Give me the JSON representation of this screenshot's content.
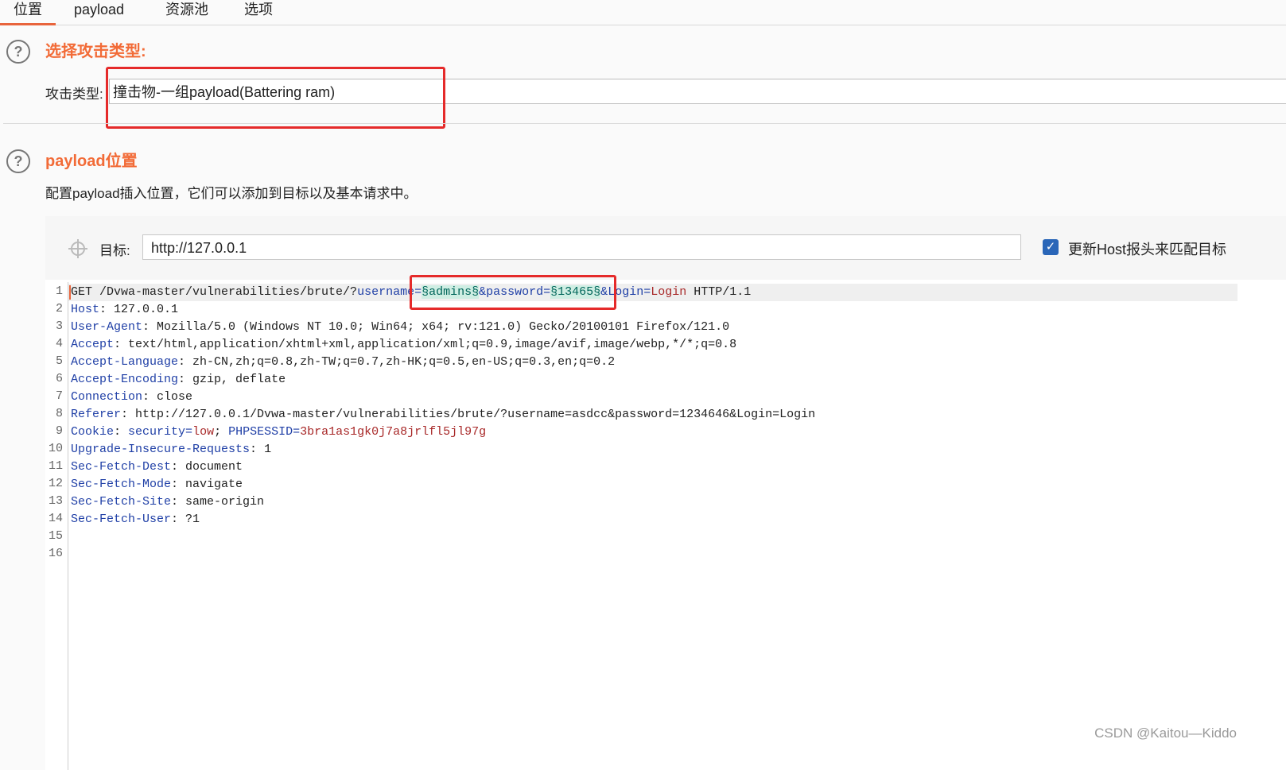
{
  "tabs": [
    {
      "label": "位置",
      "active": true
    },
    {
      "label": "payload",
      "active": false
    },
    {
      "label": "资源池",
      "active": false
    },
    {
      "label": "选项",
      "active": false
    }
  ],
  "attack_section": {
    "title": "选择攻击类型:",
    "type_label": "攻击类型:",
    "type_value": "撞击物-一组payload(Battering ram)"
  },
  "positions_section": {
    "title": "payload位置",
    "description": "配置payload插入位置，它们可以添加到目标以及基本请求中。",
    "target_label": "目标:",
    "target_value": "http://127.0.0.1",
    "update_host_label": "更新Host报头来匹配目标",
    "update_host_checked": true
  },
  "request": {
    "line1": {
      "method_path": "GET /Dvwa-master/vulnerabilities/brute/?",
      "p1_name": "username",
      "eq1": "=",
      "p1_value": "§admins§",
      "amp1": "&",
      "p2_name": "password",
      "eq2": "=",
      "p2_value": "§13465§",
      "amp2": "&",
      "p3_name": "Login",
      "eq3": "=",
      "p3_value": "Login",
      "version": " HTTP/1.1"
    },
    "headers": [
      {
        "name": "Host",
        "value": "127.0.0.1"
      },
      {
        "name": "User-Agent",
        "value": "Mozilla/5.0 (Windows NT 10.0; Win64; x64; rv:121.0) Gecko/20100101 Firefox/121.0"
      },
      {
        "name": "Accept",
        "value": "text/html,application/xhtml+xml,application/xml;q=0.9,image/avif,image/webp,*/*;q=0.8"
      },
      {
        "name": "Accept-Language",
        "value": "zh-CN,zh;q=0.8,zh-TW;q=0.7,zh-HK;q=0.5,en-US;q=0.3,en;q=0.2"
      },
      {
        "name": "Accept-Encoding",
        "value": "gzip, deflate"
      },
      {
        "name": "Connection",
        "value": "close"
      },
      {
        "name": "Referer",
        "value": "http://127.0.0.1/Dvwa-master/vulnerabilities/brute/?username=asdcc&password=1234646&Login=Login"
      }
    ],
    "cookie": {
      "name": "Cookie",
      "k1": "security",
      "v1": "low",
      "sep": "; ",
      "k2": "PHPSESSID",
      "v2": "3bra1as1gk0j7a8jrlfl5jl97g"
    },
    "headers2": [
      {
        "name": "Upgrade-Insecure-Requests",
        "value": "1"
      },
      {
        "name": "Sec-Fetch-Dest",
        "value": "document"
      },
      {
        "name": "Sec-Fetch-Mode",
        "value": "navigate"
      },
      {
        "name": "Sec-Fetch-Site",
        "value": "same-origin"
      },
      {
        "name": "Sec-Fetch-User",
        "value": "?1"
      }
    ],
    "line_numbers": [
      "1",
      "2",
      "3",
      "4",
      "5",
      "6",
      "7",
      "8",
      "9",
      "10",
      "11",
      "12",
      "13",
      "14",
      "15",
      "16"
    ]
  },
  "watermark": "CSDN @Kaitou—Kiddo",
  "colors": {
    "accent": "#f26b37",
    "highlight_box": "#e52a2a",
    "checkbox": "#2a66b8"
  }
}
